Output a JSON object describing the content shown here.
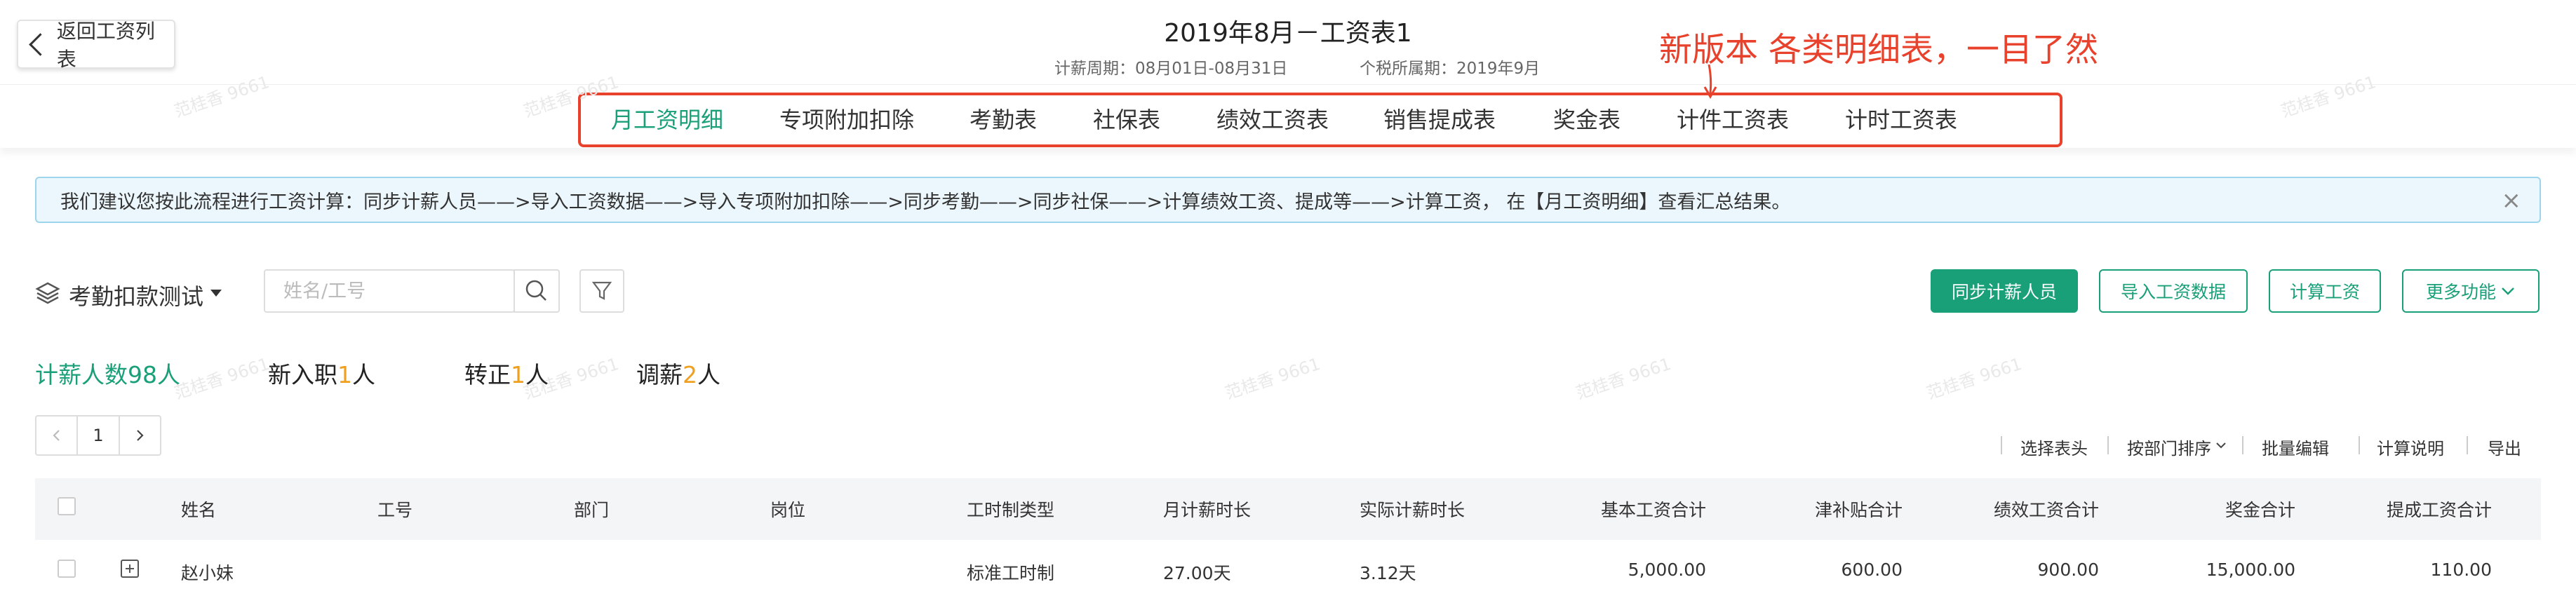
{
  "header": {
    "back_label": "返回工资列表",
    "title": "2019年8月－工资表1",
    "period": "计薪周期：08月01日-08月31日",
    "tax_period": "个税所属期：2019年9月"
  },
  "tabs": [
    {
      "label": "月工资明细",
      "active": true
    },
    {
      "label": "专项附加扣除"
    },
    {
      "label": "考勤表"
    },
    {
      "label": "社保表"
    },
    {
      "label": "绩效工资表"
    },
    {
      "label": "销售提成表"
    },
    {
      "label": "奖金表"
    },
    {
      "label": "计件工资表"
    },
    {
      "label": "计时工资表"
    }
  ],
  "annotation": "新版本  各类明细表，一目了然",
  "watermark": "范桂香 9661",
  "alert": "我们建议您按此流程进行工资计算：同步计薪人员——>导入工资数据——>导入专项附加扣除——>同步考勤——>同步社保——>计算绩效工资、提成等——>计算工资， 在【月工资明细】查看汇总结果。",
  "toolbar": {
    "dept_label": "考勤扣款测试",
    "search_placeholder": "姓名/工号",
    "buttons": [
      "同步计薪人员",
      "导入工资数据",
      "计算工资",
      "更多功能"
    ]
  },
  "stats": {
    "paid_label": "计薪人数",
    "paid_count": "98",
    "paid_unit": "人",
    "new_label": "新入职",
    "new_count": "1",
    "new_unit": "人",
    "regular_label": "转正",
    "regular_count": "1",
    "regular_unit": "人",
    "adjust_label": "调薪",
    "adjust_count": "2",
    "adjust_unit": "人"
  },
  "pager": {
    "page": "1"
  },
  "actions": [
    "选择表头",
    "按部门排序",
    "批量编辑",
    "计算说明",
    "导出"
  ],
  "table": {
    "columns": [
      "姓名",
      "工号",
      "部门",
      "岗位",
      "工时制类型",
      "月计薪时长",
      "实际计薪时长",
      "基本工资合计",
      "津补贴合计",
      "绩效工资合计",
      "奖金合计",
      "提成工资合计"
    ],
    "rows": [
      {
        "name": "赵小妹",
        "emp_no": "",
        "dept": "",
        "position": "",
        "hours_type": "标准工时制",
        "month_hours": "27.00天",
        "actual_hours": "3.12天",
        "base": "5,000.00",
        "allowance": "600.00",
        "performance": "900.00",
        "bonus": "15,000.00",
        "commission": "110.00"
      }
    ]
  },
  "colors": {
    "accent": "#1aa079",
    "annotation": "#e8412c",
    "highlight_number": "#f0a020"
  }
}
